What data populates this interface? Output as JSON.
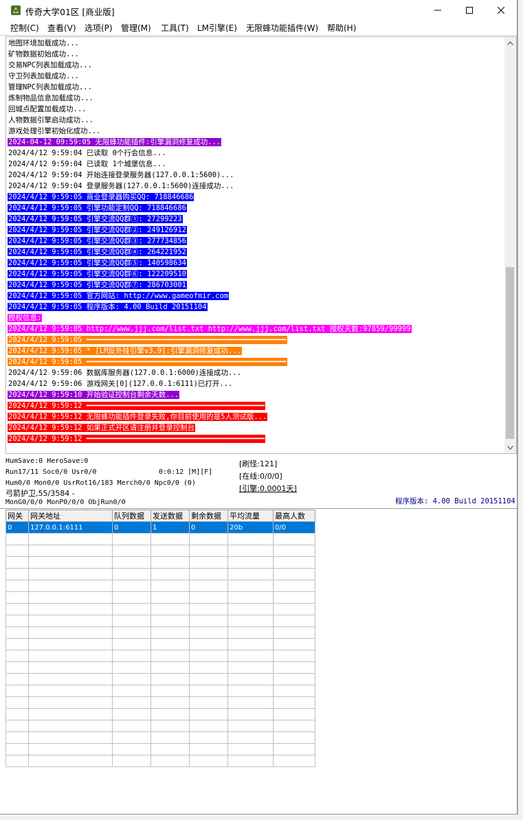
{
  "window": {
    "title": "传奇大学01区 [商业版]"
  },
  "menu": [
    "控制(C)",
    "查看(V)",
    "选项(P)",
    "管理(M)",
    "工具(T)",
    "LM引擎(E)",
    "无限蜂功能插件(W)",
    "帮助(H)"
  ],
  "colors": {
    "purple": "#9400d3",
    "blue": "#0000ff",
    "magenta": "#ff00ff",
    "orange": "#ff7f00",
    "red": "#ff0000",
    "selection": "#0078d7"
  },
  "log": [
    {
      "text": "地图环境加载成功...",
      "bg": "",
      "fg": "#000000"
    },
    {
      "text": "矿物数据初始成功...",
      "bg": "",
      "fg": "#000000"
    },
    {
      "text": "交易NPC列表加载成功...",
      "bg": "",
      "fg": "#000000"
    },
    {
      "text": "守卫列表加载成功...",
      "bg": "",
      "fg": "#000000"
    },
    {
      "text": "管理NPC列表加载成功...",
      "bg": "",
      "fg": "#000000"
    },
    {
      "text": "炼制物品信息加载成功...",
      "bg": "",
      "fg": "#000000"
    },
    {
      "text": "回城点配置加载成功...",
      "bg": "",
      "fg": "#000000"
    },
    {
      "text": "人物数据引擎启动成功...",
      "bg": "",
      "fg": "#000000"
    },
    {
      "text": "游戏处理引擎初始化成功...",
      "bg": "",
      "fg": "#000000"
    },
    {
      "text": "2024-04-12 09:59:05 无限蜂功能插件:引擎漏洞修复成功...",
      "bg": "#9400d3",
      "fg": "#ffffff"
    },
    {
      "text": "2024/4/12 9:59:04 已读取 0个行会信息...",
      "bg": "",
      "fg": "#000000"
    },
    {
      "text": "2024/4/12 9:59:04 已读取 1个城堡信息...",
      "bg": "",
      "fg": "#000000"
    },
    {
      "text": "2024/4/12 9:59:04 开始连接登录服务器(127.0.0.1:5600)...",
      "bg": "",
      "fg": "#000000"
    },
    {
      "text": "2024/4/12 9:59:04 登录服务器(127.0.0.1:5600)连接成功...",
      "bg": "",
      "fg": "#000000"
    },
    {
      "text": "2024/4/12 9:59:05 商业登录器购买QQ: 718846686",
      "bg": "#0000ff",
      "fg": "#ffffff"
    },
    {
      "text": "2024/4/12 9:59:05 引擎功能定制QQ: 718846686",
      "bg": "#0000ff",
      "fg": "#ffffff"
    },
    {
      "text": "2024/4/12 9:59:05 引擎交流QQ群①: 27299223",
      "bg": "#0000ff",
      "fg": "#ffffff"
    },
    {
      "text": "2024/4/12 9:59:05 引擎交流QQ群②: 249126912",
      "bg": "#0000ff",
      "fg": "#ffffff"
    },
    {
      "text": "2024/4/12 9:59:05 引擎交流QQ群③: 277734856",
      "bg": "#0000ff",
      "fg": "#ffffff"
    },
    {
      "text": "2024/4/12 9:59:05 引擎交流QQ群④: 264221952",
      "bg": "#0000ff",
      "fg": "#ffffff"
    },
    {
      "text": "2024/4/12 9:59:05 引擎交流QQ群⑤: 140598634",
      "bg": "#0000ff",
      "fg": "#ffffff"
    },
    {
      "text": "2024/4/12 9:59:05 引擎交流QQ群⑥: 122209510",
      "bg": "#0000ff",
      "fg": "#ffffff"
    },
    {
      "text": "2024/4/12 9:59:05 引擎交流QQ群⑦: 286703001",
      "bg": "#0000ff",
      "fg": "#ffffff"
    },
    {
      "text": "2024/4/12 9:59:05 官方网站: http://www.gameofmir.com",
      "bg": "#0000ff",
      "fg": "#ffffff"
    },
    {
      "text": "2024/4/12 9:59:05 程序版本: 4.00 Build 20151104",
      "bg": "#0000ff",
      "fg": "#ffffff"
    },
    {
      "text": "授权信息:",
      "bg": "#ff00ff",
      "fg": "#ffffff"
    },
    {
      "text": "2024/4/12 9:59:05 http://www.jjj.com/list.txt http://www.jjj.com/list.txt 授权天数:97859/99999",
      "bg": "#ff00ff",
      "fg": "#ffffff"
    },
    {
      "text": "2024/4/12 9:59:05 ━━━━━━━━━━━━━━━━━━━━━━━━━━━━━━━━━━━━━━━━━━━━━━",
      "bg": "#ff7f00",
      "fg": "#ffffff"
    },
    {
      "text": "2024/4/12 9:59:05 * [LM反外挂引擎v3.9]:引擎漏洞修复成功...",
      "bg": "#ff7f00",
      "fg": "#ffffff"
    },
    {
      "text": "2024/4/12 9:59:05 ━━━━━━━━━━━━━━━━━━━━━━━━━━━━━━━━━━━━━━━━━━━━━━",
      "bg": "#ff7f00",
      "fg": "#ffffff"
    },
    {
      "text": "2024/4/12 9:59:06 数据库服务器(127.0.0.1:6000)连接成功...",
      "bg": "",
      "fg": "#000000"
    },
    {
      "text": "2024/4/12 9:59:06 游戏网关[0](127.0.0.1:6111)已打开...",
      "bg": "",
      "fg": "#000000"
    },
    {
      "text": "2024/4/12 9:59:10 开始验证控制台剩余天数...",
      "bg": "#9400d3",
      "fg": "#ffffff"
    },
    {
      "text": "2024/4/12 9:59:12 ━━━━━━━━━━━━━━━━━━━━━━━━━━━━━━━━━━━━━━━━━",
      "bg": "#ff0000",
      "fg": "#ffffff"
    },
    {
      "text": "2024/4/12 9:59:12 无限蜂功能插件登录失败,你目前使用的是5人测试版...",
      "bg": "#ff0000",
      "fg": "#ffffff"
    },
    {
      "text": "2024/4/12 9:59:12 如果正式开区请注册并登录控制台",
      "bg": "#ff0000",
      "fg": "#ffffff"
    },
    {
      "text": "2024/4/12 9:59:12 ━━━━━━━━━━━━━━━━━━━━━━━━━━━━━━━━━━━━━━━━━",
      "bg": "#ff0000",
      "fg": "#ffffff"
    }
  ],
  "status": {
    "line1": "HumSave:0 HeroSave:0",
    "line2": "Run17/11 Soc0/0 Usr0/0",
    "line2b": "0:0:12 [M][F]",
    "line3": "Hum0/0 Mon0/0 UsrRot16/183 Merch0/0 Npc0/0 (0)",
    "line4": "弓箭护卫,55/3584 -",
    "line5": "MonG0/0/0 MonP0/0/0 ObjRun0/0",
    "refresh": "[刷怪:121]",
    "online": "[在线:0/0/0]",
    "engine": "[引擎:0.0001天]",
    "version": "程序版本: 4.00 Build 20151104"
  },
  "gateway_table": {
    "columns": [
      "网关",
      "网关地址",
      "队列数据",
      "发送数据",
      "剩余数据",
      "平均流量",
      "最高人数"
    ],
    "rows": [
      [
        "0",
        "127.0.0.1:6111",
        "0",
        "1",
        "0",
        "20b",
        "0/0"
      ]
    ]
  }
}
